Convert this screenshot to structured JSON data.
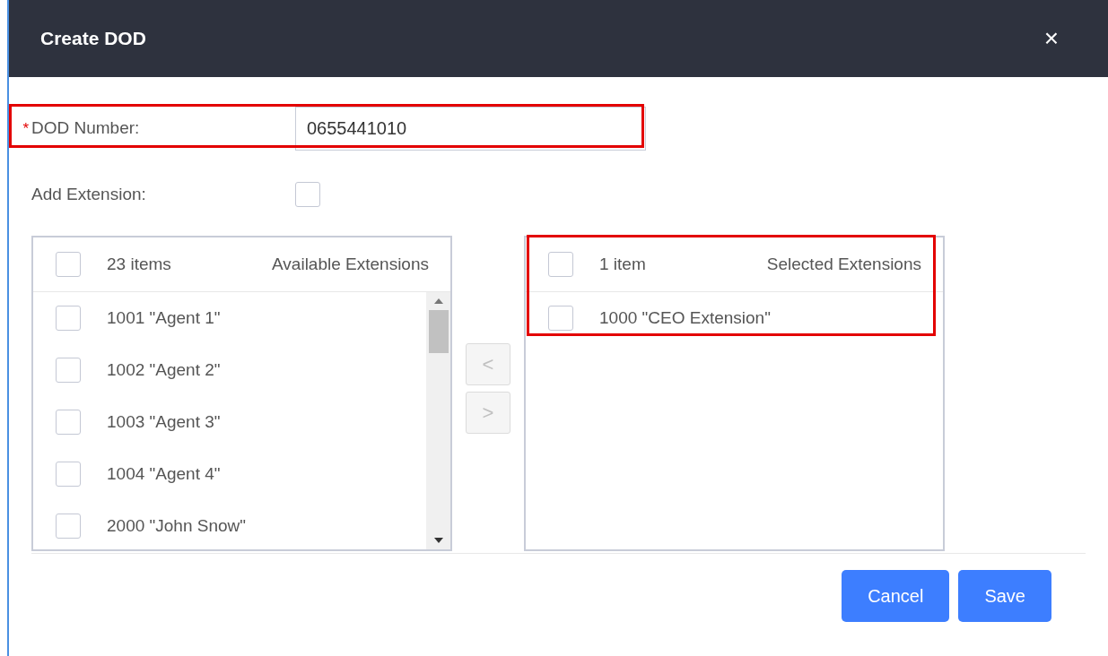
{
  "dialog": {
    "title": "Create DOD",
    "close": "×"
  },
  "fields": [
    {
      "kind": "text",
      "label": "DOD Number:",
      "required_mark": "*",
      "value": "0655441010",
      "highlighted": true
    },
    {
      "kind": "checkbox",
      "label": "Add Extension:",
      "checked": false,
      "highlighted": false
    }
  ],
  "transfer": {
    "lists": [
      {
        "count": "23 items",
        "title": "Available Extensions",
        "all_checked": false,
        "highlighted": false,
        "scrollable": true,
        "items": [
          {
            "label": "1001 \"Agent 1\"",
            "checked": false
          },
          {
            "label": "1002 \"Agent 2\"",
            "checked": false
          },
          {
            "label": "1003 \"Agent 3\"",
            "checked": false
          },
          {
            "label": "1004 \"Agent 4\"",
            "checked": false
          },
          {
            "label": "2000 \"John Snow\"",
            "checked": false
          }
        ]
      },
      {
        "count": "1 item",
        "title": "Selected Extensions",
        "all_checked": false,
        "highlighted": true,
        "scrollable": false,
        "items": [
          {
            "label": "1000 \"CEO Extension\"",
            "checked": false
          }
        ]
      }
    ],
    "buttons": [
      {
        "label": "<",
        "disabled": true
      },
      {
        "label": ">",
        "disabled": true
      }
    ]
  },
  "actions": [
    {
      "label": "Cancel"
    },
    {
      "label": "Save"
    }
  ]
}
